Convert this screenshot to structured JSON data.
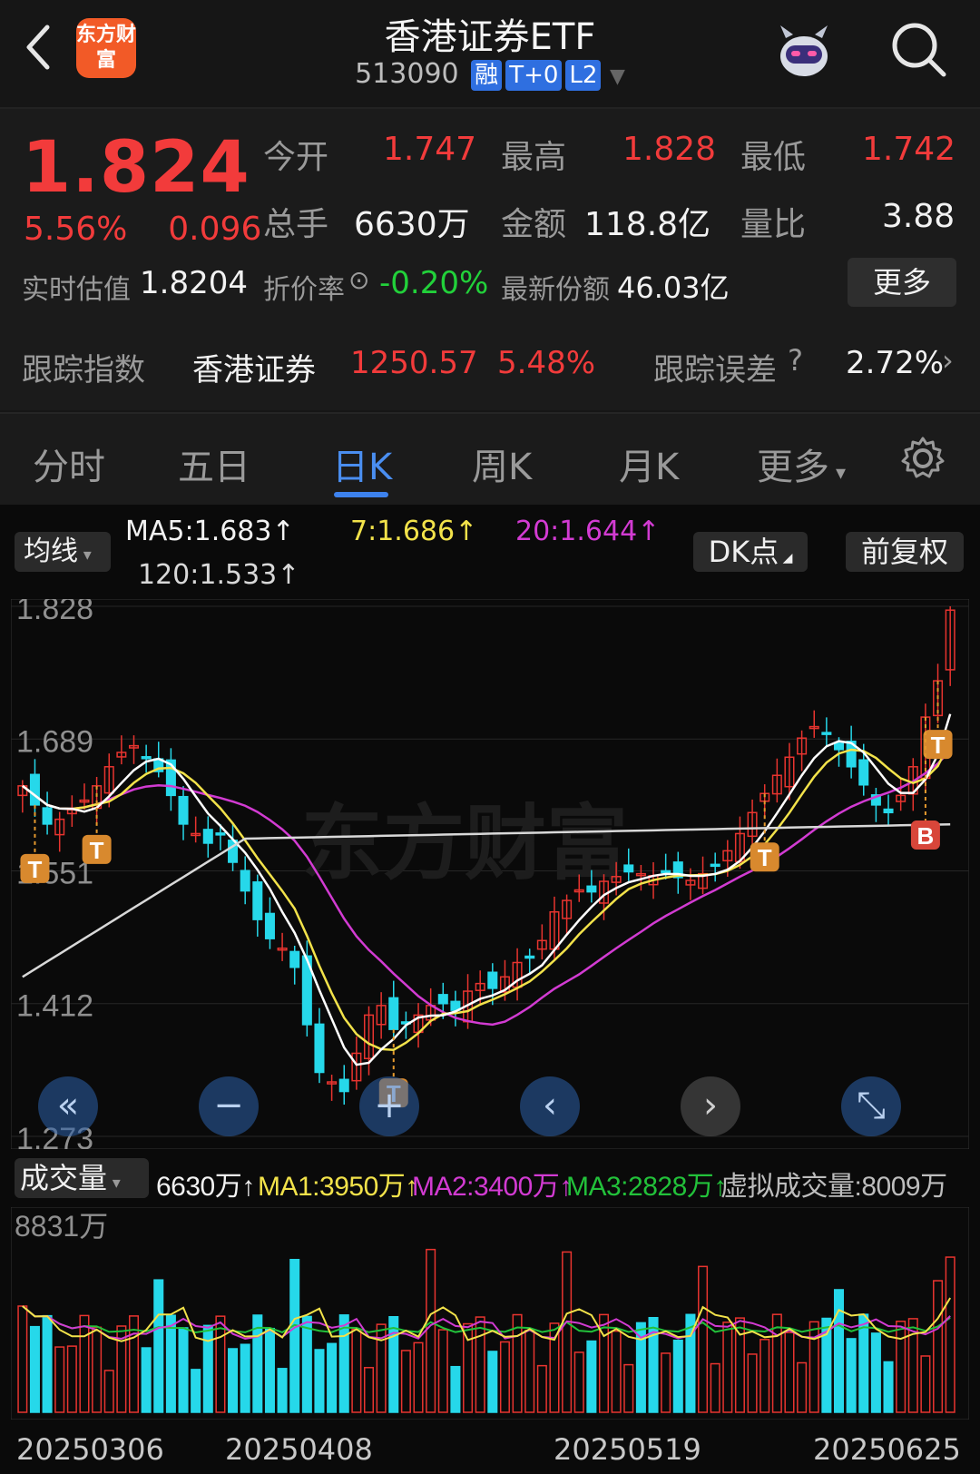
{
  "header": {
    "title": "香港证券ETF",
    "code": "513090",
    "tags": [
      "融",
      "T+0",
      "L2"
    ],
    "logo_text": "东方财富"
  },
  "quote": {
    "price": "1.824",
    "change_pct": "5.56%",
    "change_abs": "0.096",
    "open_label": "今开",
    "open": "1.747",
    "high_label": "最高",
    "high": "1.828",
    "low_label": "最低",
    "low": "1.742",
    "volume_label": "总手",
    "volume": "6630万",
    "amount_label": "金额",
    "amount": "118.8亿",
    "ratio_label": "量比",
    "ratio": "3.88",
    "iopv_label": "实时估值",
    "iopv": "1.8204",
    "discount_label": "折价率",
    "discount": "-0.20%",
    "shares_label": "最新份额",
    "shares": "46.03亿",
    "more_label": "更多",
    "track_label": "跟踪指数",
    "track_name": "香港证券",
    "track_value": "1250.57",
    "track_pct": "5.48%",
    "track_err_label": "跟踪误差",
    "track_err": "2.72%"
  },
  "tabs": [
    "分时",
    "五日",
    "日K",
    "周K",
    "月K",
    "更多"
  ],
  "active_tab": 2,
  "ma_bar": {
    "selector": "均线",
    "ma5": "MA5:1.683↑",
    "ma7": "7:1.686↑",
    "ma20": "20:1.644↑",
    "ma120": "120:1.533↑",
    "dk_label": "DK点",
    "adjust_label": "前复权"
  },
  "volume_bar": {
    "selector": "成交量",
    "vol": "6630万↑",
    "ma1": "MA1:3950万↑",
    "ma2": "MA2:3400万↑",
    "ma3": "MA3:2828万↑",
    "virtual": "虚拟成交量:8009万"
  },
  "chart_data": {
    "type": "candlestick",
    "y_ticks": [
      "1.828",
      "1.689",
      "1.551",
      "1.412",
      "1.273"
    ],
    "ylim": [
      1.273,
      1.828
    ],
    "volume_max_label": "8831万",
    "dates": [
      "20250306",
      "20250408",
      "20250519",
      "20250625"
    ],
    "markers": [
      "T",
      "T",
      "T",
      "T",
      "T",
      "B"
    ],
    "ma_colors": {
      "ma5": "#ffffff",
      "ma7": "#f2e24a",
      "ma20": "#d23bd2",
      "ma120": "#d8d8d8"
    },
    "closes": [
      1.64,
      1.62,
      1.6,
      1.605,
      1.615,
      1.625,
      1.64,
      1.66,
      1.675,
      1.682,
      1.67,
      1.655,
      1.63,
      1.6,
      1.59,
      1.58,
      1.59,
      1.56,
      1.53,
      1.5,
      1.48,
      1.47,
      1.45,
      1.39,
      1.34,
      1.33,
      1.32,
      1.36,
      1.4,
      1.41,
      1.385,
      1.392,
      1.4,
      1.41,
      1.412,
      1.405,
      1.425,
      1.433,
      1.428,
      1.44,
      1.455,
      1.46,
      1.478,
      1.508,
      1.52,
      1.531,
      1.529,
      1.54,
      1.545,
      1.55,
      1.548,
      1.546,
      1.55,
      1.544,
      1.541,
      1.548,
      1.556,
      1.572,
      1.59,
      1.612,
      1.632,
      1.651,
      1.67,
      1.69,
      1.702,
      1.694,
      1.678,
      1.66,
      1.641,
      1.62,
      1.612,
      1.63,
      1.66,
      1.712,
      1.75,
      1.824
    ]
  },
  "controls": [
    "«",
    "−",
    "+",
    "‹",
    "›",
    "⤡"
  ]
}
